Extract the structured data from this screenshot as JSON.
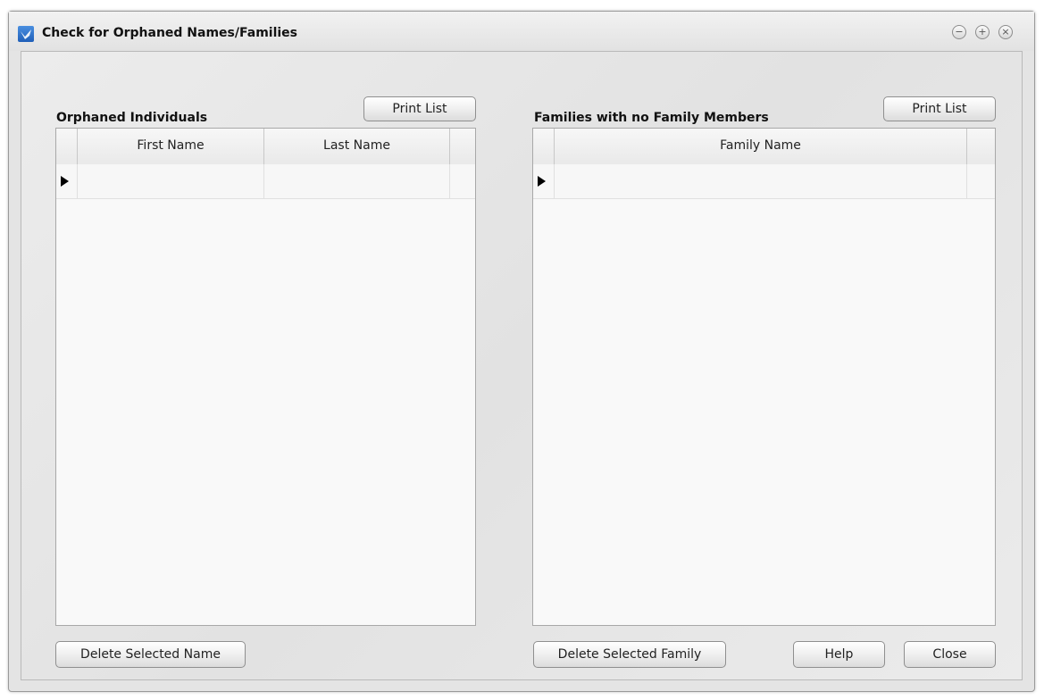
{
  "window": {
    "title": "Check for Orphaned Names/Families",
    "controls": {
      "minimize": "−",
      "maximize": "+",
      "close": "×"
    }
  },
  "left_panel": {
    "label": "Orphaned Individuals",
    "print_button": "Print List",
    "columns": [
      "First Name",
      "Last Name"
    ],
    "delete_button": "Delete Selected Name"
  },
  "right_panel": {
    "label": "Families with no Family Members",
    "print_button": "Print List",
    "columns": [
      "Family Name"
    ],
    "delete_button": "Delete Selected Family"
  },
  "footer": {
    "help_button": "Help",
    "close_button": "Close"
  },
  "icons": {
    "app": "app-icon",
    "row_indicator": "row-pointer-icon"
  }
}
